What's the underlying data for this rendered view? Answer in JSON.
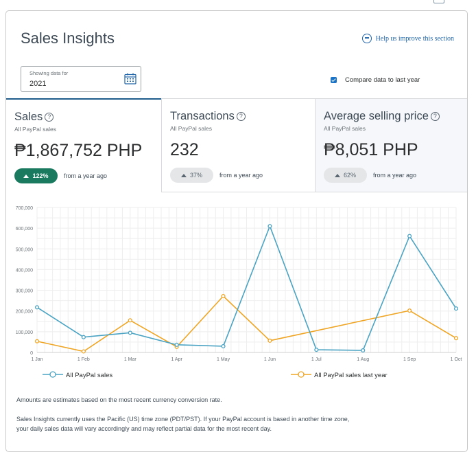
{
  "page": {
    "title": "Sales Insights",
    "help_link": "Help us improve this section",
    "date_filter": {
      "label": "Showing data for",
      "value": "2021"
    },
    "compare": {
      "label": "Compare data to last year",
      "checked": true
    }
  },
  "tabs": [
    {
      "title": "Sales",
      "subtitle": "All PayPal sales",
      "value": "₱1,867,752 PHP",
      "change": "122%",
      "from": "from a year ago"
    },
    {
      "title": "Transactions",
      "subtitle": "All PayPal sales",
      "value": "232",
      "change": "37%",
      "from": "from a year ago"
    },
    {
      "title": "Average selling price",
      "subtitle": "All PayPal sales",
      "value": "₱8,051 PHP",
      "change": "62%",
      "from": "from a year ago"
    }
  ],
  "colors": {
    "series_current": "#4aa3c3",
    "series_last_year": "#efa524",
    "accent_green": "#1a7a60"
  },
  "chart_data": {
    "type": "line",
    "x": [
      "1 Jan",
      "1 Feb",
      "1 Mar",
      "1 Apr",
      "1 May",
      "1 Jun",
      "1 Jul",
      "1 Aug",
      "1 Sep",
      "1 Oct"
    ],
    "y_ticks": [
      "0",
      "100,000",
      "200,000",
      "300,000",
      "400,000",
      "500,000",
      "600,000",
      "700,000"
    ],
    "ylim": [
      0,
      700000
    ],
    "grid": true,
    "legend_position": "bottom",
    "series": [
      {
        "name": "All PayPal sales",
        "color": "#4aa3c3",
        "points": [
          [
            "1 Jan",
            218000
          ],
          [
            "1 Feb",
            74000
          ],
          [
            "1 Mar",
            95000
          ],
          [
            "1 Apr",
            37000
          ],
          [
            "1 May",
            30000
          ],
          [
            "1 Jun",
            610000
          ],
          [
            "1 Jul",
            13000
          ],
          [
            "1 Aug",
            10000
          ],
          [
            "1 Sep",
            562000
          ],
          [
            "1 Oct",
            212000
          ]
        ]
      },
      {
        "name": "All PayPal sales last year",
        "color": "#efa524",
        "points": [
          [
            "1 Jan",
            54000
          ],
          [
            "1 Feb",
            5000
          ],
          [
            "1 Mar",
            155000
          ],
          [
            "1 Apr",
            27000
          ],
          [
            "1 May",
            272000
          ],
          [
            "1 Jun",
            57000
          ],
          [
            "1 Sep",
            202000
          ],
          [
            "1 Oct",
            69000
          ]
        ]
      }
    ]
  },
  "footnotes": [
    "Amounts are estimates based on the most recent currency conversion rate.",
    "Sales Insights currently uses the Pacific (US) time zone (PDT/PST). If your PayPal account is based in another time zone,",
    "your daily sales data will vary accordingly and may reflect partial data for the most recent day."
  ]
}
